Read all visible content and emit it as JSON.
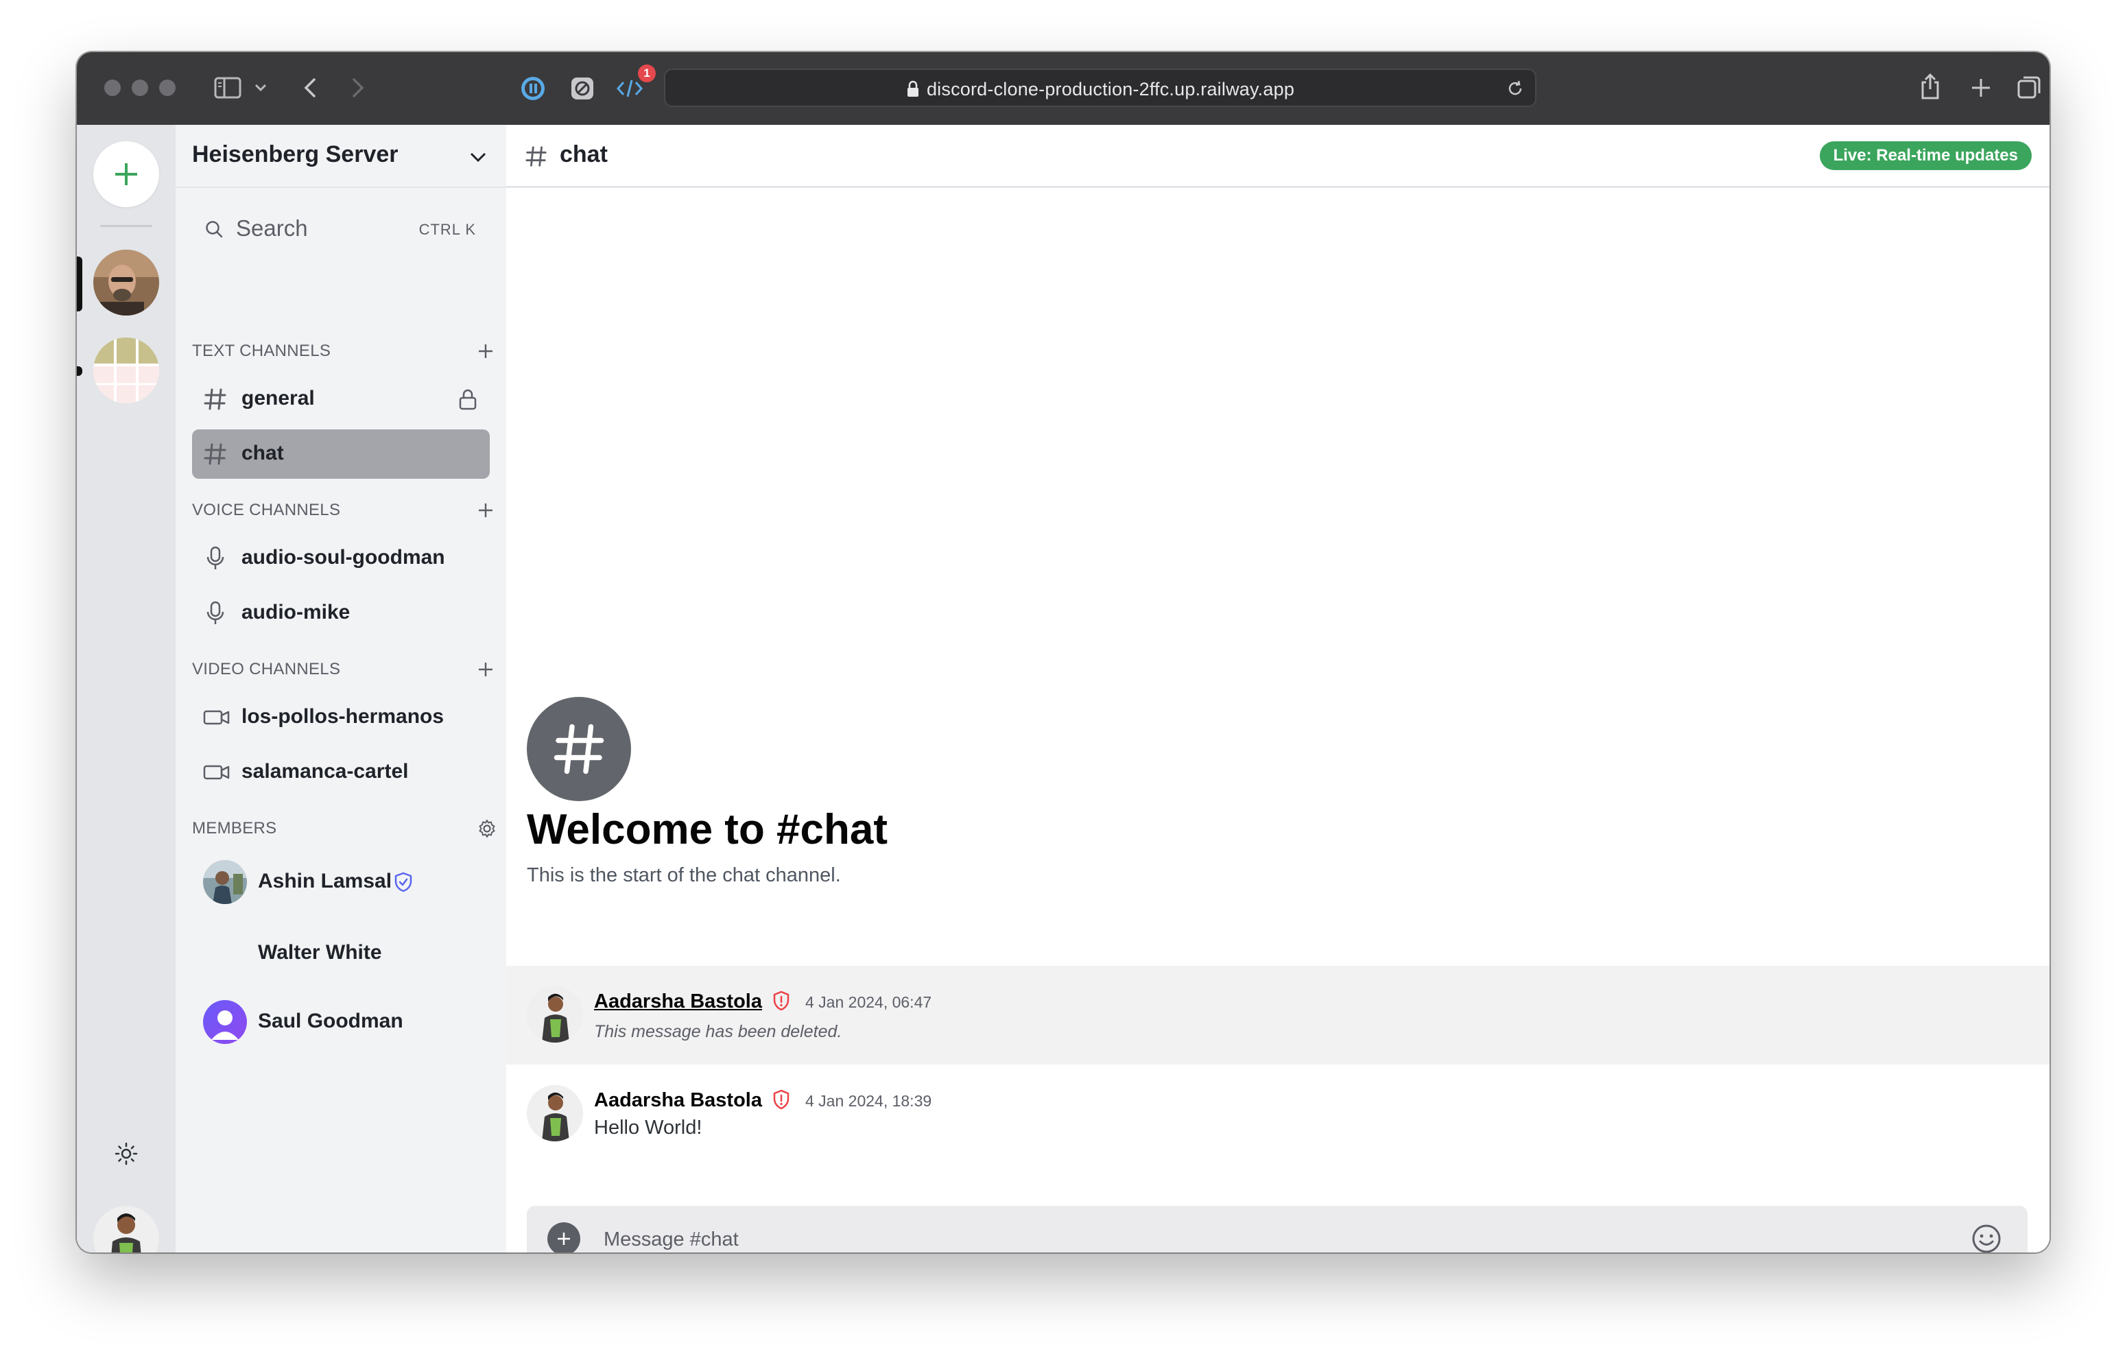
{
  "browser": {
    "url": "discord-clone-production-2ffc.up.railway.app",
    "extension_badge": "1"
  },
  "server": {
    "name": "Heisenberg Server"
  },
  "search": {
    "label": "Search",
    "shortcut": "CTRL K"
  },
  "sections": {
    "text": {
      "title": "TEXT CHANNELS",
      "channels": [
        {
          "name": "general",
          "locked": true
        },
        {
          "name": "chat",
          "active": true
        }
      ]
    },
    "voice": {
      "title": "VOICE CHANNELS",
      "channels": [
        {
          "name": "audio-soul-goodman"
        },
        {
          "name": "audio-mike"
        }
      ]
    },
    "video": {
      "title": "VIDEO CHANNELS",
      "channels": [
        {
          "name": "los-pollos-hermanos"
        },
        {
          "name": "salamanca-cartel"
        }
      ]
    },
    "members": {
      "title": "MEMBERS",
      "list": [
        {
          "name": "Ashin Lamsal",
          "badge": "shield-icon"
        },
        {
          "name": "Walter White"
        },
        {
          "name": "Saul Goodman"
        }
      ]
    }
  },
  "channel": {
    "name": "chat",
    "live_badge": "Live: Real-time updates",
    "welcome_title": "Welcome to #chat",
    "welcome_subtitle": "This is the start of the chat channel."
  },
  "messages": [
    {
      "author": "Aadarsha Bastola",
      "timestamp": "4 Jan 2024, 06:47",
      "content": "This message has been deleted.",
      "deleted": true
    },
    {
      "author": "Aadarsha Bastola",
      "timestamp": "4 Jan 2024, 18:39",
      "content": "Hello World!",
      "deleted": false
    }
  ],
  "composer": {
    "placeholder": "Message #chat"
  },
  "colors": {
    "accent_green": "#3ba55d",
    "admin_red": "#ed4245",
    "moderator_blue": "#5865f2",
    "active_channel_bg": "#a3a5aa"
  }
}
